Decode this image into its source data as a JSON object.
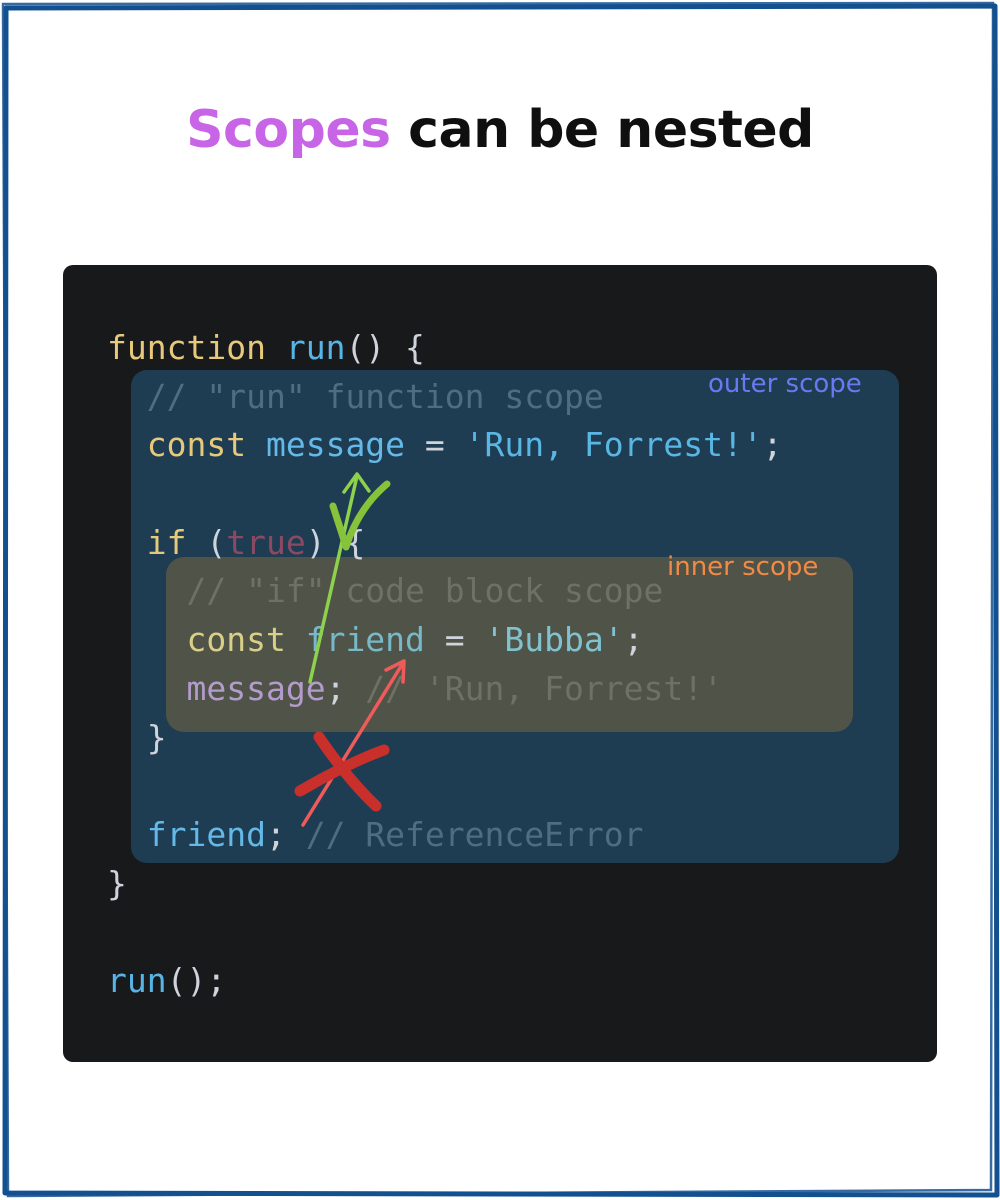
{
  "title": {
    "highlight": "Scopes",
    "rest": "can be nested"
  },
  "labels": {
    "outer_scope": "outer scope",
    "inner_scope": "inner scope"
  },
  "code": {
    "line1_kw": "function",
    "line1_fn": "run",
    "line1_rest": "() {",
    "line2_comment": "// \"run\" function scope",
    "line3_kw": "const",
    "line3_var": "message",
    "line3_eq": " = ",
    "line3_str": "'Run, Forrest!'",
    "line3_end": ";",
    "line5_kw": "if",
    "line5_open": " (",
    "line5_true": "true",
    "line5_close": ") {",
    "line6_comment": "// \"if\" code block scope",
    "line7_kw": "const",
    "line7_var": "friend",
    "line7_eq": " = ",
    "line7_str": "'Bubba'",
    "line7_end": ";",
    "line8_var": "message",
    "line8_semi": ";",
    "line8_comment": " // 'Run, Forrest!'",
    "line9": "}",
    "line11_var": "friend",
    "line11_semi": ";",
    "line11_comment": " // ReferenceError",
    "line12": "}",
    "line14_fn": "run",
    "line14_rest": "();"
  },
  "colors": {
    "frame": "#13508f",
    "title_highlight": "#c865e6",
    "panel": "#18191b",
    "outer_scope_fill": "#1f3d52",
    "inner_scope_fill": "#4f5348",
    "outer_label": "#6a79f1",
    "inner_label": "#f08a46",
    "allowed_arrow": "#8dd14c",
    "blocked_arrow": "#ef5b5b",
    "cross_mark": "#c9302c"
  },
  "annotations": {
    "allowed_access_mark": "check-icon",
    "blocked_access_mark": "cross-icon"
  }
}
